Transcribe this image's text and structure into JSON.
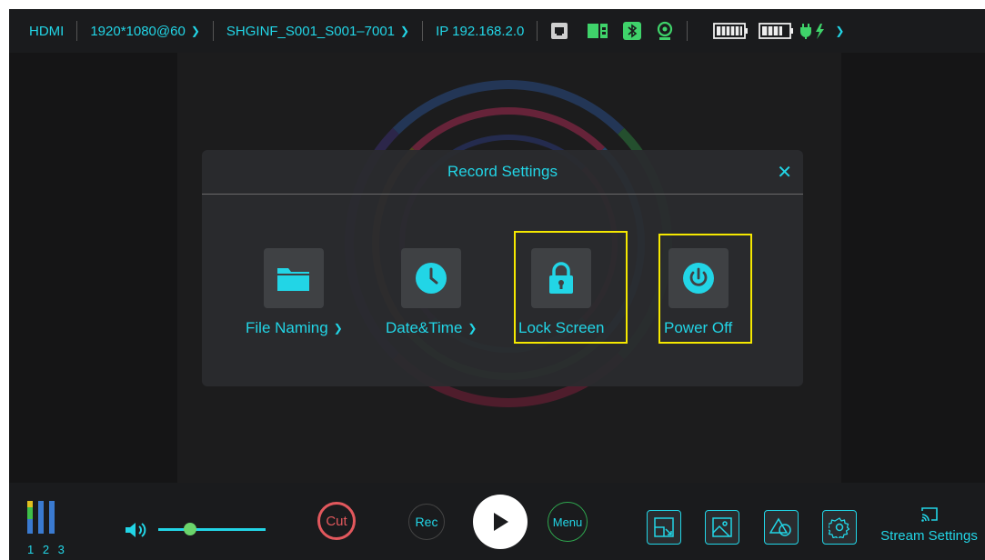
{
  "topbar": {
    "source": "HDMI",
    "resolution": "1920*1080@60",
    "filename": "SHGINF_S001_S001–7001",
    "ip": "IP 192.168.2.0",
    "chevron": "❯"
  },
  "dialog": {
    "title": "Record Settings",
    "close": "✕",
    "options": [
      {
        "label": "File Naming",
        "icon": "folder-icon",
        "has_arrow": true
      },
      {
        "label": "Date&Time",
        "icon": "clock-icon",
        "has_arrow": true
      },
      {
        "label": "Lock Screen",
        "icon": "lock-icon",
        "has_arrow": false,
        "highlighted": true
      },
      {
        "label": "Power Off",
        "icon": "power-icon",
        "has_arrow": false,
        "highlighted": true
      }
    ]
  },
  "bottombar": {
    "meter_labels": "1 2 3",
    "cut_label": "Cut",
    "rec_label": "Rec",
    "menu_label": "Menu",
    "stream_label": "Stream Settings",
    "volume_level": 0.3
  },
  "colors": {
    "accent": "#22d5e6",
    "cut_ring": "#e2585d",
    "menu_ring": "#2fa84f",
    "highlight": "#f5e800",
    "meter_green": "#3fbf4a",
    "meter_blue": "#3a7ad0"
  }
}
